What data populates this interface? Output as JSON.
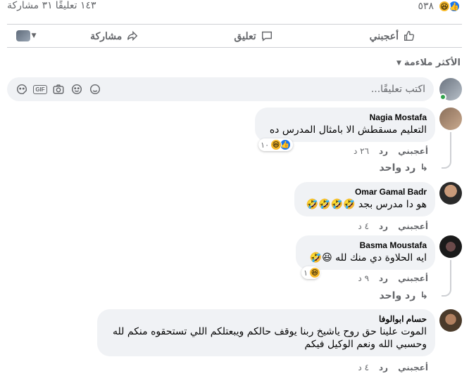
{
  "stats": {
    "reaction_count": "٥٣٨",
    "comments_text": "١٤٣ تعليقًا",
    "shares_text": "٣١ مشاركة"
  },
  "actions": {
    "like": "أعجبني",
    "comment": "تعليق",
    "share": "مشاركة"
  },
  "sort": {
    "label": "الأكثر ملاءمة"
  },
  "composer": {
    "placeholder": "اكتب تعليقًا..."
  },
  "comments": [
    {
      "author": "Nagia Mostafa",
      "text": "التعليم مسقطش الا بامثال المدرس ده",
      "like": "أعجبني",
      "reply": "رد",
      "time": "٢٦ د",
      "reactions": "١٠",
      "replies_label": "رد واحد"
    },
    {
      "author": "Omar Gamal Badr",
      "text": "هو دا مدرس بجد 🤣🤣🤣🤣",
      "like": "أعجبني",
      "reply": "رد",
      "time": "٤ د"
    },
    {
      "author": "Basma Moustafa",
      "text": "ايه الحلاوة دي منك لله 😆🤣",
      "like": "أعجبني",
      "reply": "رد",
      "time": "٩ د",
      "reactions": "١",
      "replies_label": "رد واحد"
    },
    {
      "author": "حسام ابوالوفا",
      "text_line1": "الموت علينا حق روح ياشيخ ربنا يوقف حالكم ويبعتلكم اللي تستحقوه منكم لله",
      "text_line2": "وحسبي الله ونعم الوكيل فيكم",
      "like": "أعجبني",
      "reply": "رد",
      "time": "٤ د"
    }
  ],
  "colors": {
    "like_blue": "#1877f2",
    "haha_yellow": "#f7b928",
    "muted": "#65676b",
    "bubble": "#f0f2f5"
  }
}
